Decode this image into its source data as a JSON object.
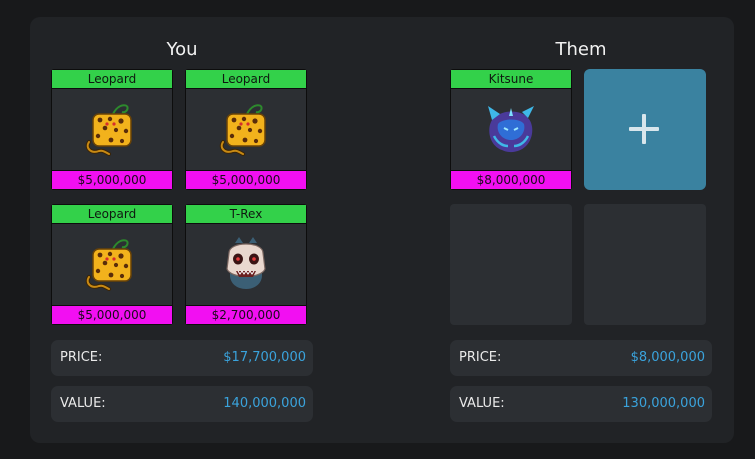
{
  "you": {
    "title": "You",
    "items": [
      {
        "name": "Leopard",
        "price": "$5,000,000",
        "icon": "leopard-fruit-icon"
      },
      {
        "name": "Leopard",
        "price": "$5,000,000",
        "icon": "leopard-fruit-icon"
      },
      {
        "name": "Leopard",
        "price": "$5,000,000",
        "icon": "leopard-fruit-icon"
      },
      {
        "name": "T-Rex",
        "price": "$2,700,000",
        "icon": "t-rex-fruit-icon"
      }
    ],
    "price_label": "PRICE:",
    "price_value": "$17,700,000",
    "value_label": "VALUE:",
    "value_value": "140,000,000"
  },
  "them": {
    "title": "Them",
    "items": [
      {
        "name": "Kitsune",
        "price": "$8,000,000",
        "icon": "kitsune-fruit-icon"
      }
    ],
    "add_icon": "plus-icon",
    "price_label": "PRICE:",
    "price_value": "$8,000,000",
    "value_label": "VALUE:",
    "value_value": "130,000,000"
  },
  "colors": {
    "name_bar": "#33d14a",
    "price_bar": "#f20ff2",
    "add_slot": "#3a82a0",
    "value_text": "#3aa3dc"
  }
}
